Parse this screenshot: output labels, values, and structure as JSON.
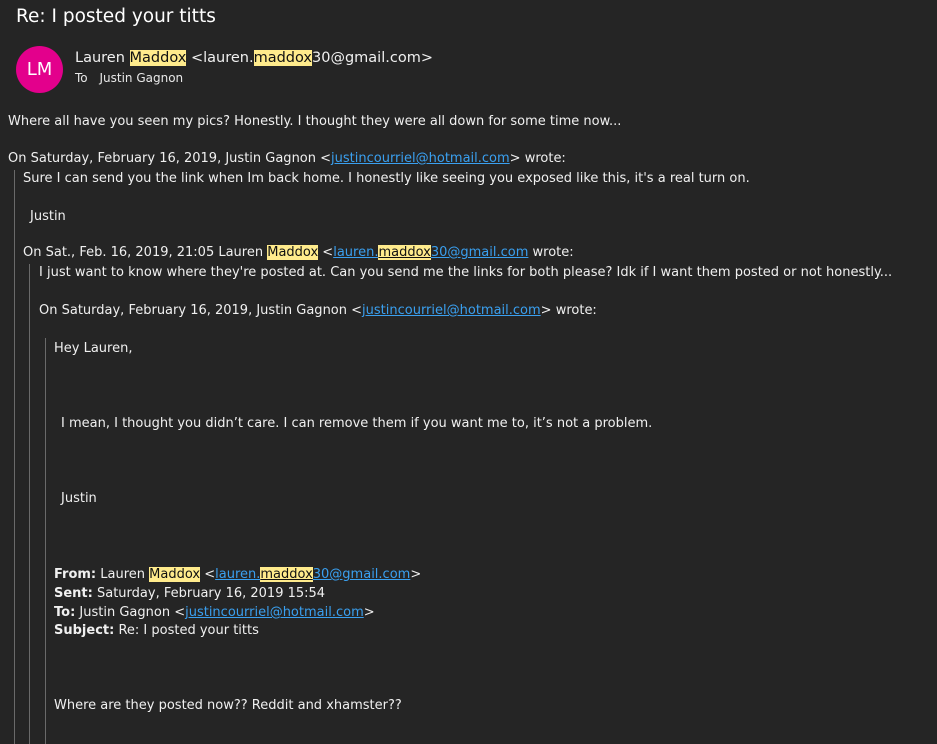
{
  "email": {
    "subject": "Re: I posted your titts",
    "avatar_initials": "LM",
    "avatar_color": "#e3008c",
    "highlight_color": "#ffeb8c",
    "link_color": "#3aa0f0",
    "sender_first": "Lauren",
    "sender_last": "Maddox",
    "sender_addr_open": "<lauren.",
    "sender_addr_hl": "maddox",
    "sender_addr_close": "30@gmail.com>",
    "to_label": "To",
    "to_name": "Justin Gagnon"
  },
  "body": {
    "line1": "Where all have you seen my pics? Honestly. I thought they were all down for some time now...",
    "q1_header_pre": "On Saturday, February 16, 2019, Justin Gagnon <",
    "q1_header_link": "justincourriel@hotmail.com",
    "q1_header_post": "> wrote:",
    "q1_line1": "Sure I can send you the link when Im back home. I honestly like seeing you exposed like this, it's a real turn on.",
    "q1_sig": "Justin",
    "q2_header_pre": "On Sat., Feb. 16, 2019, 21:05 Lauren ",
    "q2_header_hl": "Maddox",
    "q2_header_mid": " <",
    "q2_link_a": "lauren.",
    "q2_link_hl": "maddox",
    "q2_link_b": "30@gmail.com",
    "q2_header_post": " wrote:",
    "q2_line1": "I just want to know where they're posted at. Can you send me the links for both please? Idk if I want them posted or not honestly...",
    "q3_header_pre": "On Saturday, February 16, 2019, Justin Gagnon <",
    "q3_header_link": "justincourriel@hotmail.com",
    "q3_header_post": "> wrote:",
    "q4_greeting": "Hey Lauren,",
    "q4_line1": "I mean, I thought you didn’t care. I can remove them if you want me to, it’s not a problem.",
    "q4_sig": "Justin",
    "fwd_from_label": "From:",
    "fwd_from_pre": " Lauren ",
    "fwd_from_hl": "Maddox",
    "fwd_from_mid": " <",
    "fwd_from_link_a": "lauren.",
    "fwd_from_link_hl": "maddox",
    "fwd_from_link_b": "30@gmail.com",
    "fwd_from_post": ">",
    "fwd_sent_label": "Sent:",
    "fwd_sent": " Saturday, February 16, 2019 15:54",
    "fwd_to_label": "To:",
    "fwd_to_pre": " Justin Gagnon <",
    "fwd_to_link": "justincourriel@hotmail.com",
    "fwd_to_post": ">",
    "fwd_subject_label": "Subject:",
    "fwd_subject": " Re: I posted your titts",
    "q5_line1": "Where are they posted now?? Reddit and xhamster??"
  }
}
